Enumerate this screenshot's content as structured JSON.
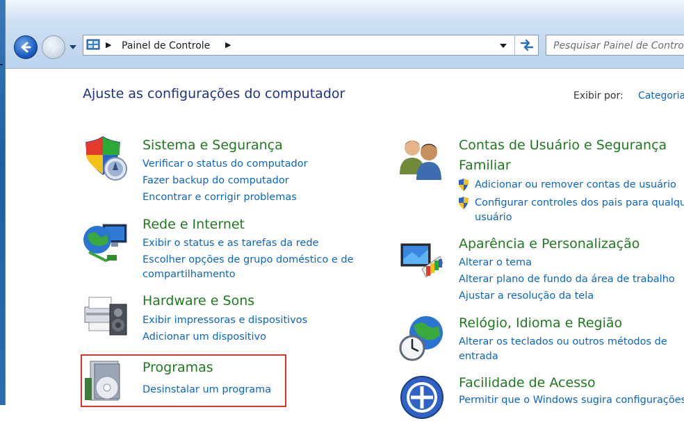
{
  "navigation": {
    "breadcrumb": "Painel de Controle",
    "search_placeholder": "Pesquisar Painel de Controle"
  },
  "header": {
    "title": "Ajuste as configurações do computador",
    "view_by_label": "Exibir por:",
    "view_by_value": "Categoria"
  },
  "categories_left": [
    {
      "title": "Sistema e Segurança",
      "icon": "shield-icon",
      "links": [
        "Verificar o status do computador",
        "Fazer backup do computador",
        "Encontrar e corrigir problemas"
      ]
    },
    {
      "title": "Rede e Internet",
      "icon": "network-globe-icon",
      "links": [
        "Exibir o status e as tarefas da rede",
        "Escolher opções de grupo doméstico e de",
        "compartilhamento"
      ]
    },
    {
      "title": "Hardware e Sons",
      "icon": "printer-speaker-icon",
      "links": [
        "Exibir impressoras e dispositivos",
        "Adicionar um dispositivo"
      ]
    },
    {
      "title": "Programas",
      "icon": "programs-disc-icon",
      "links": [
        "Desinstalar um programa"
      ]
    }
  ],
  "categories_right": [
    {
      "title_line1": "Contas de Usuário e Segurança",
      "title_line2": "Familiar",
      "icon": "users-icon",
      "links": [
        "Adicionar ou remover contas de usuário",
        "Configurar controles dos pais para qualquer",
        "usuário"
      ]
    },
    {
      "title": "Aparência e Personalização",
      "icon": "monitor-palette-icon",
      "links": [
        "Alterar o tema",
        "Alterar plano de fundo da área de trabalho",
        "Ajustar a resolução da tela"
      ]
    },
    {
      "title": "Relógio, Idioma e Região",
      "icon": "globe-clock-icon",
      "links": [
        "Alterar os teclados ou outros métodos de",
        "entrada"
      ]
    },
    {
      "title": "Facilidade de Acesso",
      "icon": "ease-of-access-icon",
      "links": [
        "Permitir que o Windows sugira configurações"
      ]
    }
  ],
  "colors": {
    "category_title": "#1f7a1f",
    "link": "#0a66c2",
    "page_title": "#1e3287",
    "highlight": "#e0322e"
  }
}
